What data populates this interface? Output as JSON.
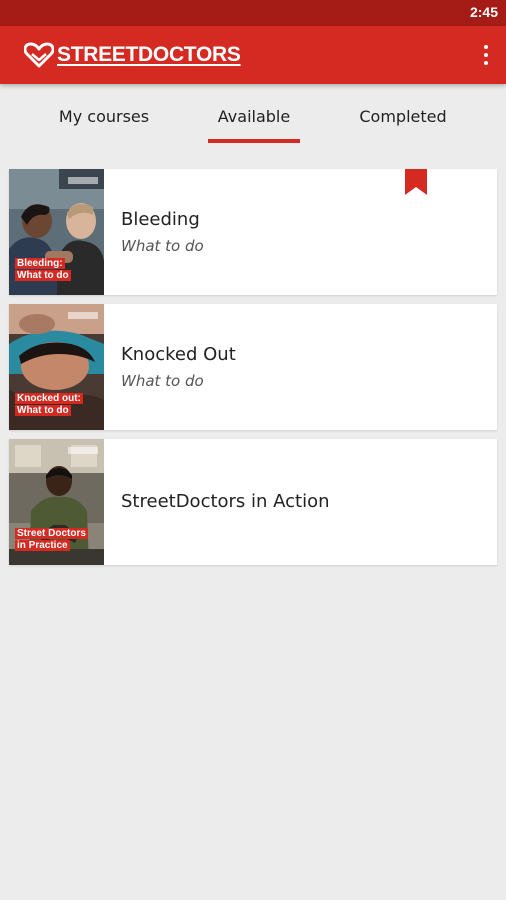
{
  "status": {
    "time": "2:45"
  },
  "app": {
    "logo_text": "STREETDOCTORS",
    "brand_color": "#d52a22",
    "menu_icon": "more-vertical-icon"
  },
  "tabs": [
    {
      "label": "My courses",
      "active": false
    },
    {
      "label": "Available",
      "active": true
    },
    {
      "label": "Completed",
      "active": false
    }
  ],
  "courses": [
    {
      "title": "Bleeding",
      "subtitle": "What to do",
      "thumb_label_1": "Bleeding:",
      "thumb_label_2": "What to do",
      "bookmarked": true
    },
    {
      "title": "Knocked Out",
      "subtitle": "What to do",
      "thumb_label_1": "Knocked out:",
      "thumb_label_2": "What to do",
      "bookmarked": false
    },
    {
      "title": "StreetDoctors in Action",
      "subtitle": "",
      "thumb_label_1": "Street Doctors",
      "thumb_label_2": "in Practice",
      "bookmarked": false
    }
  ]
}
